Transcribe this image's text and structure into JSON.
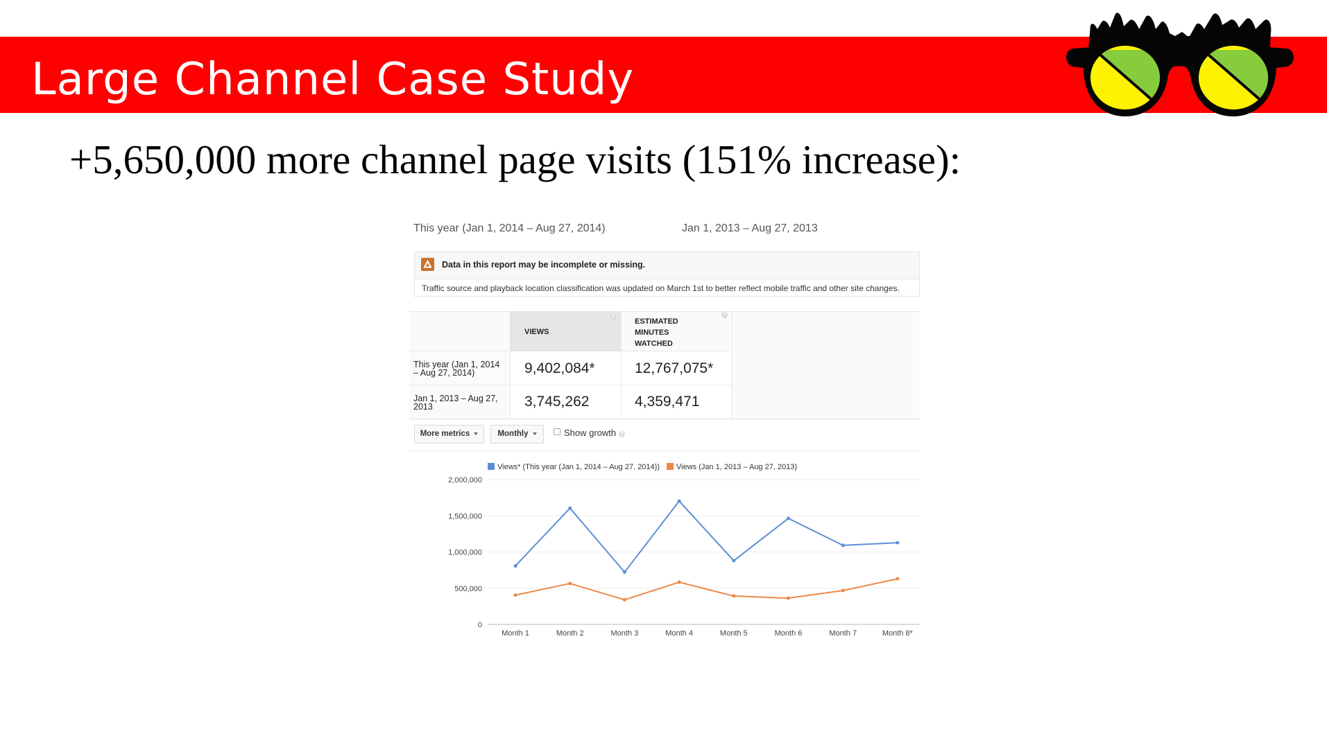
{
  "slide": {
    "title": "Large Channel Case Study",
    "subtitle": "+5,650,000 more channel page visits (151% increase):",
    "logo": "glasses-logo-icon",
    "band_color": "#fe0000"
  },
  "report": {
    "date_range_primary": "This year (Jan 1, 2014 – Aug 27, 2014)",
    "date_range_compare": "Jan 1, 2013 – Aug 27, 2013",
    "warning": {
      "icon": "warning-icon",
      "title": "Data in this report may be incomplete or missing.",
      "body": "Traffic source and playback location classification was updated on March 1st to better reflect mobile traffic and other site changes."
    },
    "table": {
      "columns": [
        "VIEWS",
        "ESTIMATED MINUTES WATCHED"
      ],
      "rows": [
        {
          "label": "This year (Jan 1, 2014 – Aug 27, 2014)",
          "views": "9,402,084*",
          "minutes": "12,767,075*"
        },
        {
          "label": "Jan 1, 2013 – Aug 27, 2013",
          "views": "3,745,262",
          "minutes": "4,359,471"
        }
      ]
    },
    "controls": {
      "more_metrics": "More metrics",
      "interval": "Monthly",
      "show_growth": "Show growth",
      "show_growth_checked": false
    }
  },
  "chart_data": {
    "type": "line",
    "title": "",
    "xlabel": "",
    "ylabel": "",
    "categories": [
      "Month 1",
      "Month 2",
      "Month 3",
      "Month 4",
      "Month 5",
      "Month 6",
      "Month 7",
      "Month 8*"
    ],
    "ylim": [
      0,
      2000000
    ],
    "yticks": [
      0,
      500000,
      1000000,
      1500000,
      2000000
    ],
    "ytick_labels": [
      "0",
      "500,000",
      "1,000,000",
      "1,500,000",
      "2,000,000"
    ],
    "grid": true,
    "legend_position": "top",
    "series": [
      {
        "name": "Views* (This year (Jan 1, 2014 – Aug 27, 2014))",
        "color": "#5b8fd3",
        "values": [
          808000,
          1605000,
          722000,
          1703000,
          880000,
          1464000,
          1092000,
          1128000
        ]
      },
      {
        "name": "Views (Jan 1, 2013 – Aug 27, 2013)",
        "color": "#ec8848",
        "values": [
          405000,
          565000,
          340000,
          583000,
          392000,
          363000,
          468000,
          630000
        ]
      }
    ]
  }
}
